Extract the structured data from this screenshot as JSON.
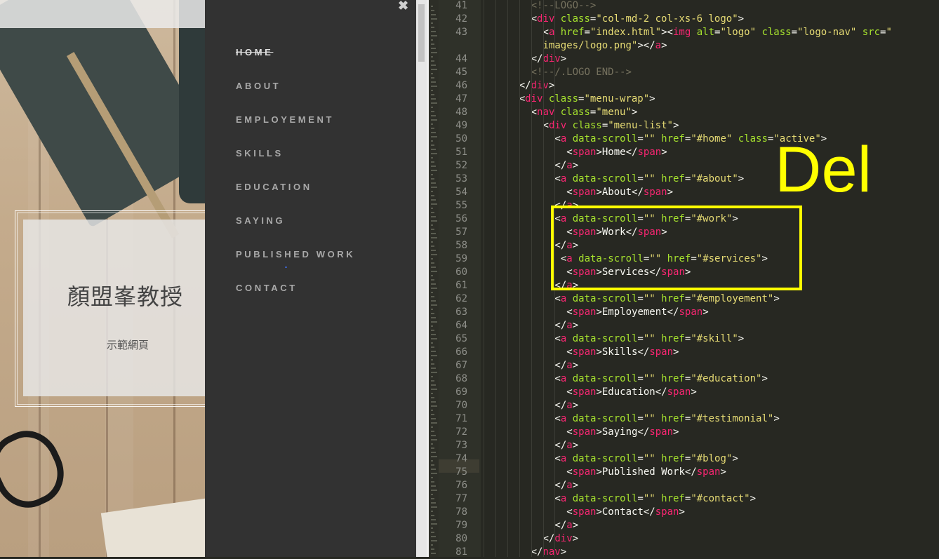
{
  "site": {
    "hero_title": "顏盟峯教授",
    "hero_subtitle": "示範網頁"
  },
  "menu": {
    "close_icon": "close-icon",
    "items": [
      {
        "label": "HOME",
        "active": true
      },
      {
        "label": "ABOUT"
      },
      {
        "label": "EMPLOYEMENT"
      },
      {
        "label": "SKILLS"
      },
      {
        "label": "EDUCATION"
      },
      {
        "label": "SAYING"
      },
      {
        "label": "PUBLISHED WORK"
      },
      {
        "label": "CONTACT"
      }
    ]
  },
  "editor": {
    "theme_colors": {
      "tag": "#f92672",
      "attr": "#a6e22e",
      "string": "#e6db74",
      "comment": "#75715e",
      "text": "#f8f8f2"
    },
    "current_line": "75",
    "lines": [
      {
        "n": "41",
        "tokens": [
          [
            "c",
            "<!--LOGO-->"
          ]
        ]
      },
      {
        "n": "42",
        "tokens": [
          [
            "w",
            "<"
          ],
          [
            "t",
            "div"
          ],
          [
            "a",
            " class"
          ],
          [
            "w",
            "="
          ],
          [
            "s",
            "\"col-md-2 col-xs-6 logo\""
          ],
          [
            "w",
            ">"
          ]
        ]
      },
      {
        "n": "43",
        "tokens": [
          [
            "w",
            "<"
          ],
          [
            "t",
            "a"
          ],
          [
            "a",
            " href"
          ],
          [
            "w",
            "="
          ],
          [
            "s",
            "\"index.html\""
          ],
          [
            "w",
            "><"
          ],
          [
            "t",
            "img"
          ],
          [
            "a",
            " alt"
          ],
          [
            "w",
            "="
          ],
          [
            "s",
            "\"logo\""
          ],
          [
            "a",
            " class"
          ],
          [
            "w",
            "="
          ],
          [
            "s",
            "\"logo-nav\""
          ],
          [
            "a",
            " src"
          ],
          [
            "w",
            "="
          ],
          [
            "s",
            "\""
          ]
        ]
      },
      {
        "n": "",
        "tokens": [
          [
            "s",
            "images/logo.png\""
          ],
          [
            "w",
            "></"
          ],
          [
            "t",
            "a"
          ],
          [
            "w",
            ">"
          ]
        ]
      },
      {
        "n": "44",
        "tokens": [
          [
            "w",
            "</"
          ],
          [
            "t",
            "div"
          ],
          [
            "w",
            ">"
          ]
        ]
      },
      {
        "n": "45",
        "tokens": [
          [
            "c",
            "<!--/.LOGO END-->"
          ]
        ]
      },
      {
        "n": "46",
        "tokens": [
          [
            "w",
            "</"
          ],
          [
            "t",
            "div"
          ],
          [
            "w",
            ">"
          ]
        ]
      },
      {
        "n": "47",
        "tokens": [
          [
            "w",
            "<"
          ],
          [
            "t",
            "div"
          ],
          [
            "a",
            " class"
          ],
          [
            "w",
            "="
          ],
          [
            "s",
            "\"menu-wrap\""
          ],
          [
            "w",
            ">"
          ]
        ]
      },
      {
        "n": "48",
        "tokens": [
          [
            "w",
            "<"
          ],
          [
            "t",
            "nav"
          ],
          [
            "a",
            " class"
          ],
          [
            "w",
            "="
          ],
          [
            "s",
            "\"menu\""
          ],
          [
            "w",
            ">"
          ]
        ]
      },
      {
        "n": "49",
        "tokens": [
          [
            "w",
            "<"
          ],
          [
            "t",
            "div"
          ],
          [
            "a",
            " class"
          ],
          [
            "w",
            "="
          ],
          [
            "s",
            "\"menu-list\""
          ],
          [
            "w",
            ">"
          ]
        ]
      },
      {
        "n": "50",
        "tokens": [
          [
            "w",
            "<"
          ],
          [
            "t",
            "a"
          ],
          [
            "a",
            " data-scroll"
          ],
          [
            "w",
            "="
          ],
          [
            "s",
            "\"\""
          ],
          [
            "a",
            " href"
          ],
          [
            "w",
            "="
          ],
          [
            "s",
            "\"#home\""
          ],
          [
            "a",
            " class"
          ],
          [
            "w",
            "="
          ],
          [
            "s",
            "\"active\""
          ],
          [
            "w",
            ">"
          ]
        ]
      },
      {
        "n": "51",
        "tokens": [
          [
            "w",
            "<"
          ],
          [
            "t",
            "span"
          ],
          [
            "w",
            ">Home</"
          ],
          [
            "t",
            "span"
          ],
          [
            "w",
            ">"
          ]
        ]
      },
      {
        "n": "52",
        "tokens": [
          [
            "w",
            "</"
          ],
          [
            "t",
            "a"
          ],
          [
            "w",
            ">"
          ]
        ]
      },
      {
        "n": "53",
        "tokens": [
          [
            "w",
            "<"
          ],
          [
            "t",
            "a"
          ],
          [
            "a",
            " data-scroll"
          ],
          [
            "w",
            "="
          ],
          [
            "s",
            "\"\""
          ],
          [
            "a",
            " href"
          ],
          [
            "w",
            "="
          ],
          [
            "s",
            "\"#about\""
          ],
          [
            "w",
            ">"
          ]
        ]
      },
      {
        "n": "54",
        "tokens": [
          [
            "w",
            "<"
          ],
          [
            "t",
            "span"
          ],
          [
            "w",
            ">About</"
          ],
          [
            "t",
            "span"
          ],
          [
            "w",
            ">"
          ]
        ]
      },
      {
        "n": "55",
        "tokens": [
          [
            "w",
            "</"
          ],
          [
            "t",
            "a"
          ],
          [
            "w",
            ">"
          ]
        ]
      },
      {
        "n": "56",
        "tokens": [
          [
            "w",
            "<"
          ],
          [
            "t",
            "a"
          ],
          [
            "a",
            " data-scroll"
          ],
          [
            "w",
            "="
          ],
          [
            "s",
            "\"\""
          ],
          [
            "a",
            " href"
          ],
          [
            "w",
            "="
          ],
          [
            "s",
            "\"#work\""
          ],
          [
            "w",
            ">"
          ]
        ]
      },
      {
        "n": "57",
        "tokens": [
          [
            "w",
            "<"
          ],
          [
            "t",
            "span"
          ],
          [
            "w",
            ">Work</"
          ],
          [
            "t",
            "span"
          ],
          [
            "w",
            ">"
          ]
        ]
      },
      {
        "n": "58",
        "tokens": [
          [
            "w",
            "</"
          ],
          [
            "t",
            "a"
          ],
          [
            "w",
            ">"
          ]
        ]
      },
      {
        "n": "59",
        "tokens": [
          [
            "w",
            "<"
          ],
          [
            "t",
            "a"
          ],
          [
            "a",
            " data-scroll"
          ],
          [
            "w",
            "="
          ],
          [
            "s",
            "\"\""
          ],
          [
            "a",
            " href"
          ],
          [
            "w",
            "="
          ],
          [
            "s",
            "\"#services\""
          ],
          [
            "w",
            ">"
          ]
        ]
      },
      {
        "n": "60",
        "tokens": [
          [
            "w",
            "<"
          ],
          [
            "t",
            "span"
          ],
          [
            "w",
            ">Services</"
          ],
          [
            "t",
            "span"
          ],
          [
            "w",
            ">"
          ]
        ]
      },
      {
        "n": "61",
        "tokens": [
          [
            "w",
            "</"
          ],
          [
            "t",
            "a"
          ],
          [
            "w",
            ">"
          ]
        ]
      },
      {
        "n": "62",
        "tokens": [
          [
            "w",
            "<"
          ],
          [
            "t",
            "a"
          ],
          [
            "a",
            " data-scroll"
          ],
          [
            "w",
            "="
          ],
          [
            "s",
            "\"\""
          ],
          [
            "a",
            " href"
          ],
          [
            "w",
            "="
          ],
          [
            "s",
            "\"#employement\""
          ],
          [
            "w",
            ">"
          ]
        ]
      },
      {
        "n": "63",
        "tokens": [
          [
            "w",
            "<"
          ],
          [
            "t",
            "span"
          ],
          [
            "w",
            ">Employement</"
          ],
          [
            "t",
            "span"
          ],
          [
            "w",
            ">"
          ]
        ]
      },
      {
        "n": "64",
        "tokens": [
          [
            "w",
            "</"
          ],
          [
            "t",
            "a"
          ],
          [
            "w",
            ">"
          ]
        ]
      },
      {
        "n": "65",
        "tokens": [
          [
            "w",
            "<"
          ],
          [
            "t",
            "a"
          ],
          [
            "a",
            " data-scroll"
          ],
          [
            "w",
            "="
          ],
          [
            "s",
            "\"\""
          ],
          [
            "a",
            " href"
          ],
          [
            "w",
            "="
          ],
          [
            "s",
            "\"#skill\""
          ],
          [
            "w",
            ">"
          ]
        ]
      },
      {
        "n": "66",
        "tokens": [
          [
            "w",
            "<"
          ],
          [
            "t",
            "span"
          ],
          [
            "w",
            ">Skills</"
          ],
          [
            "t",
            "span"
          ],
          [
            "w",
            ">"
          ]
        ]
      },
      {
        "n": "67",
        "tokens": [
          [
            "w",
            "</"
          ],
          [
            "t",
            "a"
          ],
          [
            "w",
            ">"
          ]
        ]
      },
      {
        "n": "68",
        "tokens": [
          [
            "w",
            "<"
          ],
          [
            "t",
            "a"
          ],
          [
            "a",
            " data-scroll"
          ],
          [
            "w",
            "="
          ],
          [
            "s",
            "\"\""
          ],
          [
            "a",
            " href"
          ],
          [
            "w",
            "="
          ],
          [
            "s",
            "\"#education\""
          ],
          [
            "w",
            ">"
          ]
        ]
      },
      {
        "n": "69",
        "tokens": [
          [
            "w",
            "<"
          ],
          [
            "t",
            "span"
          ],
          [
            "w",
            ">Education</"
          ],
          [
            "t",
            "span"
          ],
          [
            "w",
            ">"
          ]
        ]
      },
      {
        "n": "70",
        "tokens": [
          [
            "w",
            "</"
          ],
          [
            "t",
            "a"
          ],
          [
            "w",
            ">"
          ]
        ]
      },
      {
        "n": "71",
        "tokens": [
          [
            "w",
            "<"
          ],
          [
            "t",
            "a"
          ],
          [
            "a",
            " data-scroll"
          ],
          [
            "w",
            "="
          ],
          [
            "s",
            "\"\""
          ],
          [
            "a",
            " href"
          ],
          [
            "w",
            "="
          ],
          [
            "s",
            "\"#testimonial\""
          ],
          [
            "w",
            ">"
          ]
        ]
      },
      {
        "n": "72",
        "tokens": [
          [
            "w",
            "<"
          ],
          [
            "t",
            "span"
          ],
          [
            "w",
            ">Saying</"
          ],
          [
            "t",
            "span"
          ],
          [
            "w",
            ">"
          ]
        ]
      },
      {
        "n": "73",
        "tokens": [
          [
            "w",
            "</"
          ],
          [
            "t",
            "a"
          ],
          [
            "w",
            ">"
          ]
        ]
      },
      {
        "n": "74",
        "tokens": [
          [
            "w",
            "<"
          ],
          [
            "t",
            "a"
          ],
          [
            "a",
            " data-scroll"
          ],
          [
            "w",
            "="
          ],
          [
            "s",
            "\"\""
          ],
          [
            "a",
            " href"
          ],
          [
            "w",
            "="
          ],
          [
            "s",
            "\"#blog\""
          ],
          [
            "w",
            ">"
          ]
        ]
      },
      {
        "n": "75",
        "tokens": [
          [
            "w",
            "<"
          ],
          [
            "t",
            "span"
          ],
          [
            "w",
            ">Published Work</"
          ],
          [
            "t",
            "span"
          ],
          [
            "w",
            ">"
          ]
        ]
      },
      {
        "n": "76",
        "tokens": [
          [
            "w",
            "</"
          ],
          [
            "t",
            "a"
          ],
          [
            "w",
            ">"
          ]
        ]
      },
      {
        "n": "77",
        "tokens": [
          [
            "w",
            "<"
          ],
          [
            "t",
            "a"
          ],
          [
            "a",
            " data-scroll"
          ],
          [
            "w",
            "="
          ],
          [
            "s",
            "\"\""
          ],
          [
            "a",
            " href"
          ],
          [
            "w",
            "="
          ],
          [
            "s",
            "\"#contact\""
          ],
          [
            "w",
            ">"
          ]
        ]
      },
      {
        "n": "78",
        "tokens": [
          [
            "w",
            "<"
          ],
          [
            "t",
            "span"
          ],
          [
            "w",
            ">Contact</"
          ],
          [
            "t",
            "span"
          ],
          [
            "w",
            ">"
          ]
        ]
      },
      {
        "n": "79",
        "tokens": [
          [
            "w",
            "</"
          ],
          [
            "t",
            "a"
          ],
          [
            "w",
            ">"
          ]
        ]
      },
      {
        "n": "80",
        "tokens": [
          [
            "w",
            "</"
          ],
          [
            "t",
            "div"
          ],
          [
            "w",
            ">"
          ]
        ]
      },
      {
        "n": "81",
        "tokens": [
          [
            "w",
            "</"
          ],
          [
            "t",
            "nav"
          ],
          [
            "w",
            ">"
          ]
        ]
      }
    ]
  },
  "annotation": {
    "label": "Del"
  }
}
